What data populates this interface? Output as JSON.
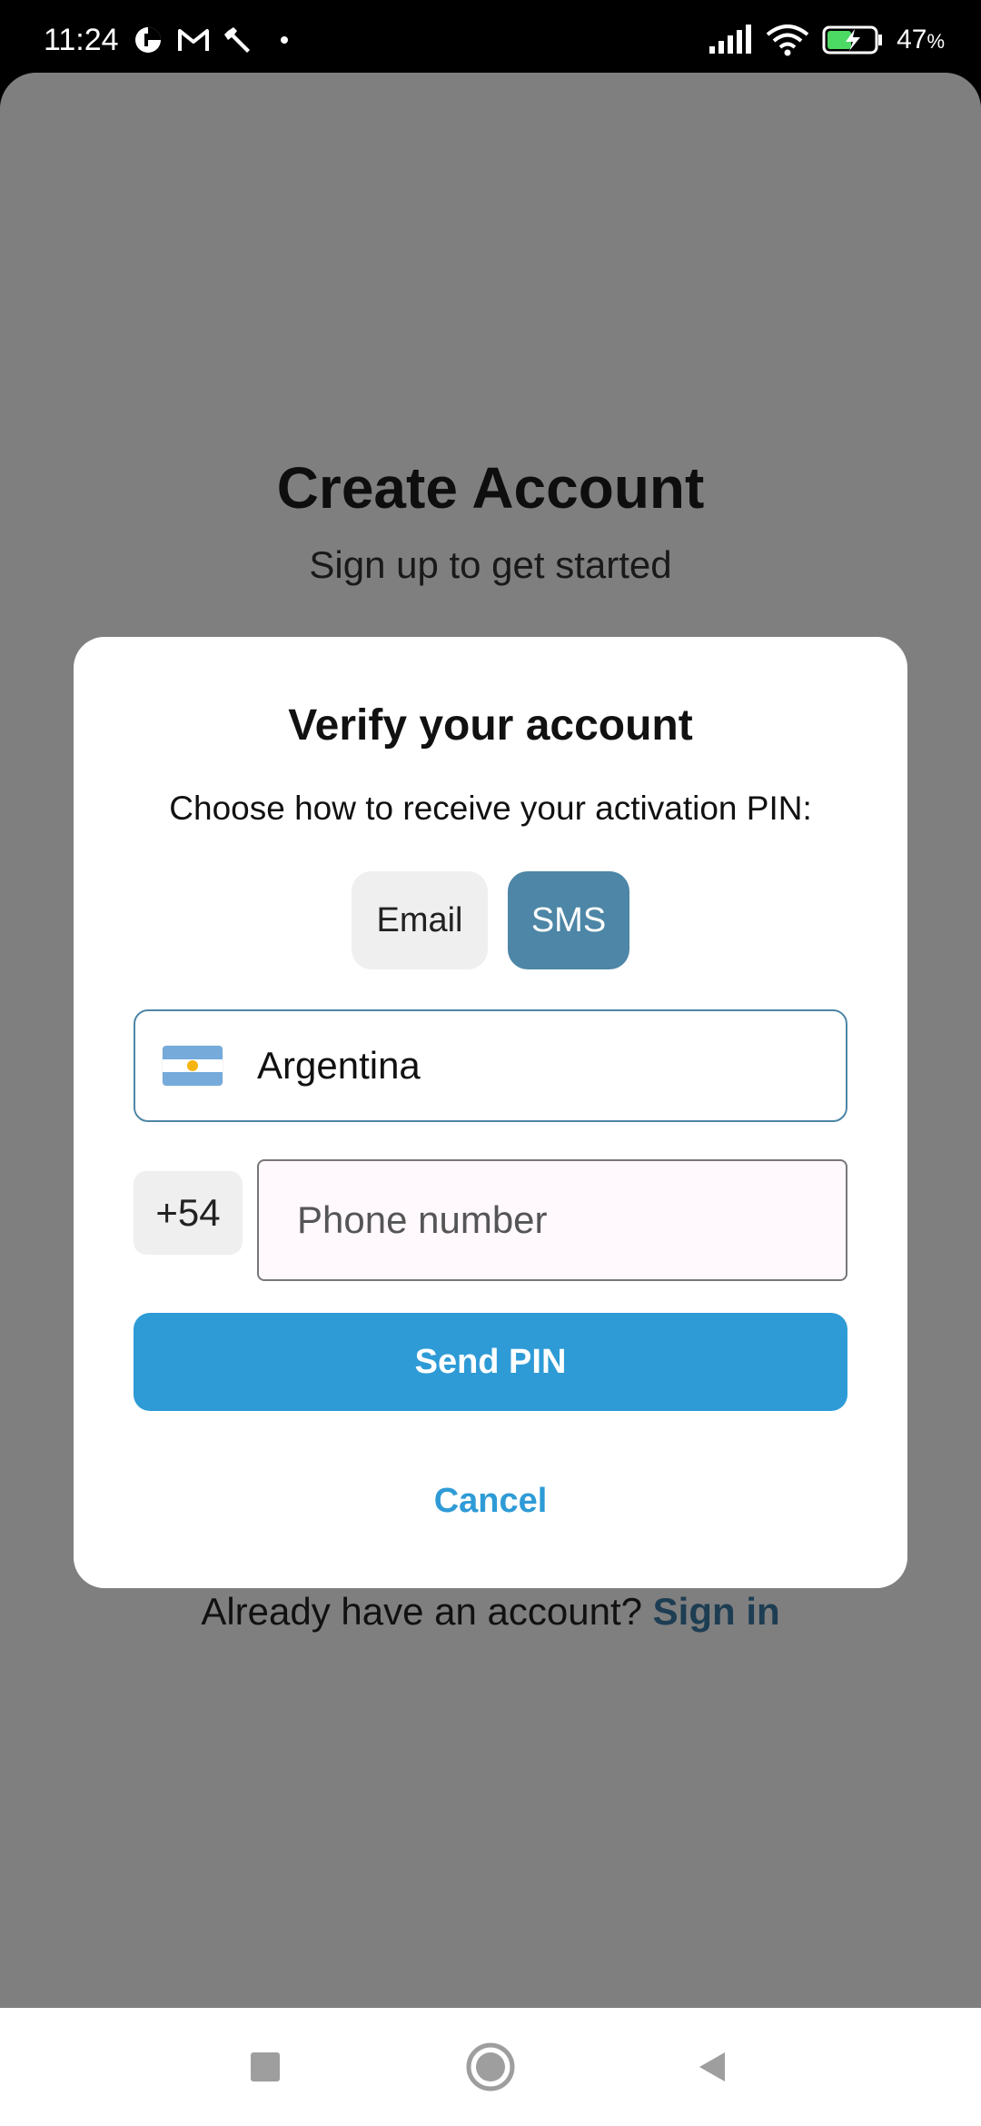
{
  "status_bar": {
    "time": "11:24",
    "battery_percent": "47",
    "battery_unit": "%",
    "icons": [
      "data-saver-icon",
      "gmail-icon",
      "wrench-icon",
      "dot-icon",
      "signal-icon",
      "wifi-icon",
      "battery-charging-icon"
    ]
  },
  "background_screen": {
    "title": "Create Account",
    "subtitle": "Sign up to get started",
    "already_have_account": "Already have an account?",
    "sign_in_link": "Sign in"
  },
  "modal": {
    "title": "Verify your account",
    "description": "Choose how to receive your activation PIN:",
    "method_options": [
      {
        "label": "Email",
        "selected": false
      },
      {
        "label": "SMS",
        "selected": true
      }
    ],
    "country": {
      "name": "Argentina",
      "flag_icon": "argentina-flag-icon"
    },
    "dial_code": "+54",
    "phone_input": {
      "placeholder": "Phone number",
      "value": ""
    },
    "send_pin_label": "Send PIN",
    "cancel_label": "Cancel"
  },
  "colors": {
    "accent": "#2e9bd6",
    "selected_toggle": "#4d86a6",
    "scrim": "rgba(0,0,0,0.5)"
  },
  "nav_bar": {
    "icons": [
      "recents-square-icon",
      "home-circle-icon",
      "back-triangle-icon"
    ]
  }
}
